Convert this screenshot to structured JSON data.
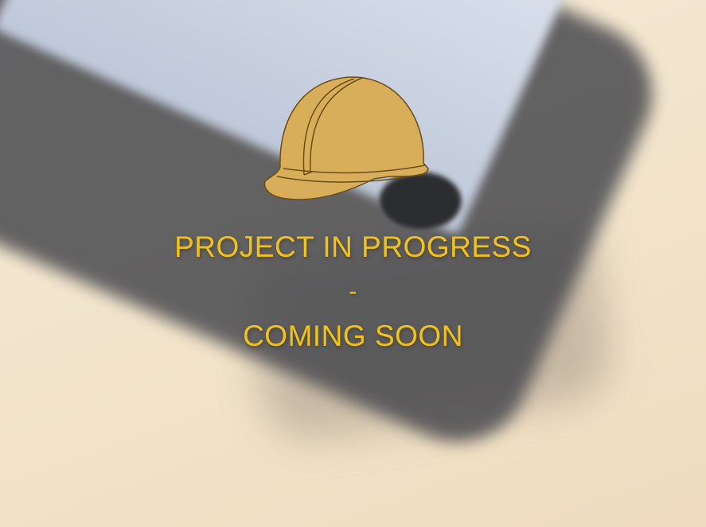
{
  "message": {
    "line1": "PROJECT IN PROGRESS",
    "separator": "-",
    "line2": "COMING SOON"
  },
  "colors": {
    "text": "#f1c21c",
    "helmet_fill": "#d9ae5a",
    "helmet_outline": "#6b4e16"
  },
  "icons": {
    "hero": "hard-hat-icon"
  }
}
